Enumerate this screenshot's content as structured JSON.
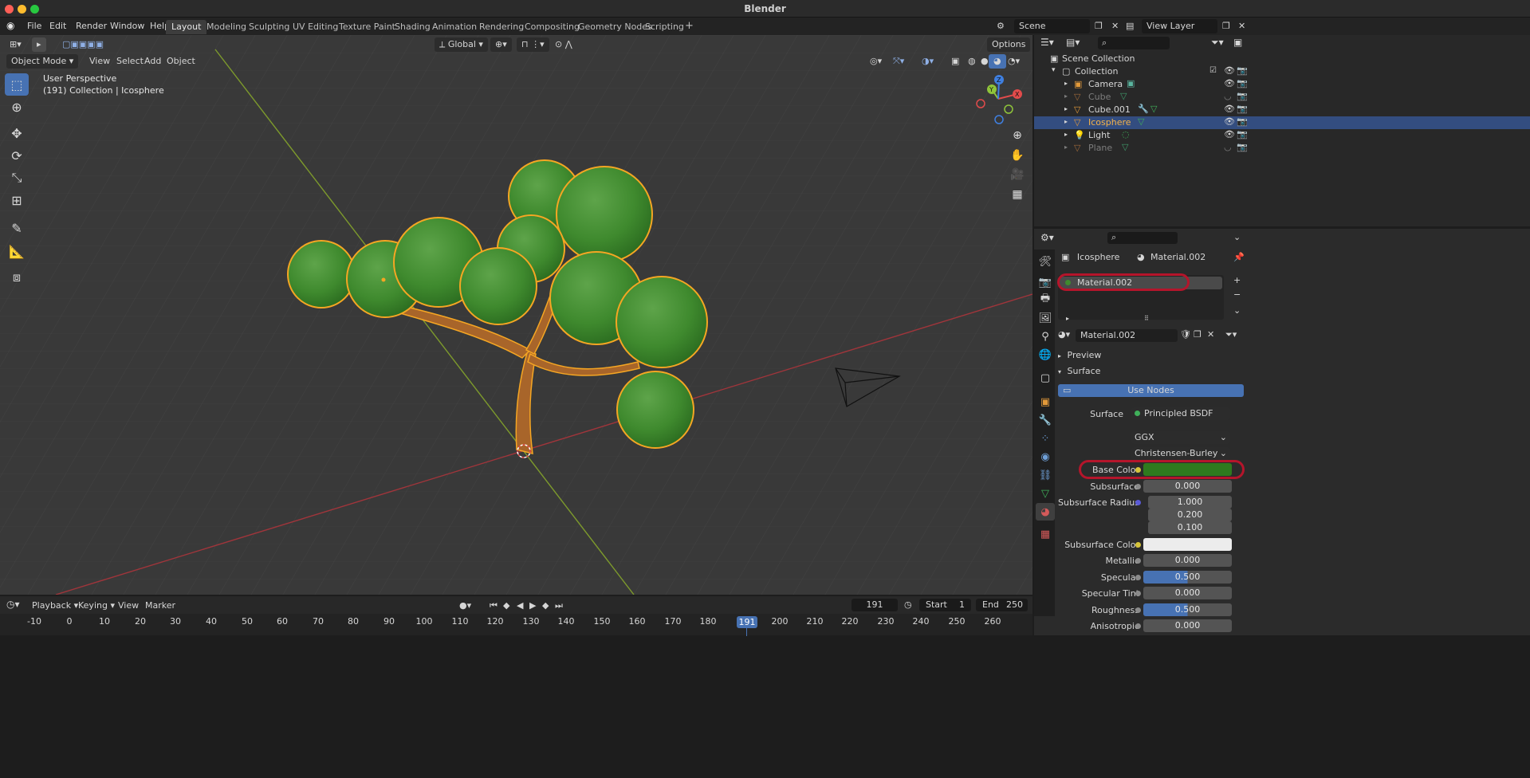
{
  "window": {
    "title": "Blender"
  },
  "menu": [
    "File",
    "Edit",
    "Render",
    "Window",
    "Help"
  ],
  "workspaces": [
    "Layout",
    "Modeling",
    "Sculpting",
    "UV Editing",
    "Texture Paint",
    "Shading",
    "Animation",
    "Rendering",
    "Compositing",
    "Geometry Nodes",
    "Scripting"
  ],
  "active_workspace": "Layout",
  "scene": {
    "scene_name": "Scene",
    "view_layer": "View Layer"
  },
  "viewport": {
    "mode": "Object Mode",
    "header_menus": [
      "View",
      "Select",
      "Add",
      "Object"
    ],
    "orientation": "Global",
    "options": "Options",
    "overlay_line1": "User Perspective",
    "overlay_line2": "(191) Collection | Icosphere",
    "gizmo_axes": [
      "X",
      "Y",
      "Z"
    ]
  },
  "outliner": {
    "root": "Scene Collection",
    "collection": "Collection",
    "items": [
      {
        "name": "Camera",
        "dim": false,
        "selected": false
      },
      {
        "name": "Cube",
        "dim": true,
        "selected": false
      },
      {
        "name": "Cube.001",
        "dim": false,
        "selected": false
      },
      {
        "name": "Icosphere",
        "dim": false,
        "selected": true
      },
      {
        "name": "Light",
        "dim": false,
        "selected": false
      },
      {
        "name": "Plane",
        "dim": true,
        "selected": false
      }
    ]
  },
  "properties": {
    "object_name": "Icosphere",
    "material_name": "Material.002",
    "slot_name": "Material.002",
    "datablock_name": "Material.002",
    "preview_label": "Preview",
    "surface_panel_label": "Surface",
    "use_nodes": "Use Nodes",
    "surface_label": "Surface",
    "surface_value": "Principled BSDF",
    "distribution": "GGX",
    "subsurface_method": "Christensen-Burley",
    "fields": {
      "base_color_label": "Base Color",
      "base_color": "#2f7a1e",
      "subsurface_label": "Subsurface",
      "subsurface": "0.000",
      "subsurface_radius_label": "Subsurface Radius",
      "subsurface_radius": [
        "1.000",
        "0.200",
        "0.100"
      ],
      "subsurface_color_label": "Subsurface Color",
      "subsurface_color": "#ececec",
      "metallic_label": "Metallic",
      "metallic": "0.000",
      "specular_label": "Specular",
      "specular": "0.500",
      "specular_tint_label": "Specular Tint",
      "specular_tint": "0.000",
      "roughness_label": "Roughness",
      "roughness": "0.500",
      "anisotropic_label": "Anisotropic",
      "anisotropic": "0.000"
    }
  },
  "timeline": {
    "menus": [
      "Playback",
      "Keying",
      "View",
      "Marker"
    ],
    "current_frame": "191",
    "start_label": "Start",
    "start": "1",
    "end_label": "End",
    "end": "250",
    "ticks": [
      "-10",
      "0",
      "10",
      "20",
      "30",
      "40",
      "50",
      "60",
      "70",
      "80",
      "90",
      "100",
      "110",
      "120",
      "130",
      "140",
      "150",
      "160",
      "170",
      "180",
      "190",
      "200",
      "210",
      "220",
      "230",
      "240",
      "250",
      "260"
    ]
  },
  "colors": {
    "accent": "#4772b3",
    "highlight": "#b5152b",
    "selection_outline": "#f5a623",
    "leaf": "#3f8a2e",
    "trunk": "#a8652a"
  }
}
